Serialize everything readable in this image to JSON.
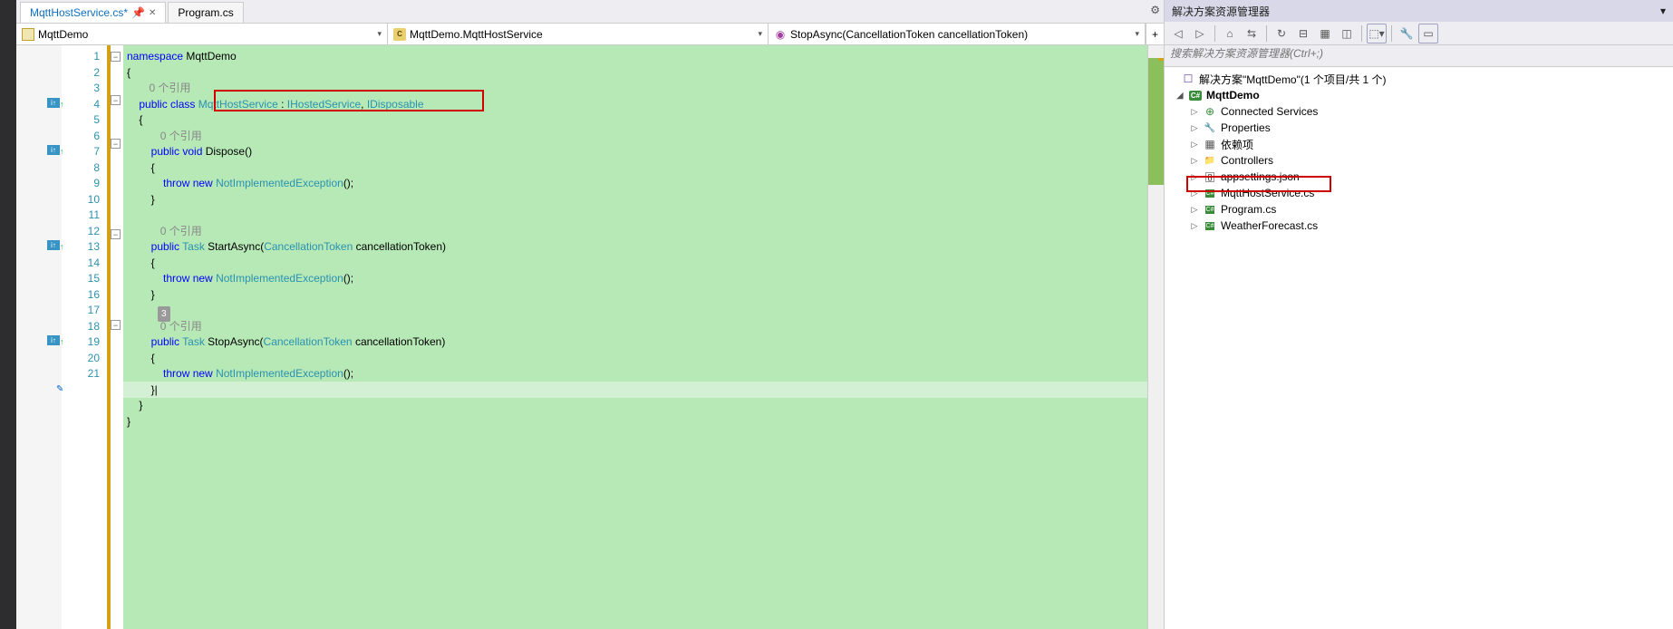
{
  "tabs": {
    "active": "MqttHostService.cs*",
    "pinned": "Program.cs",
    "close_glyph": "✕",
    "pin_glyph": "📌",
    "gear_glyph": "⚙"
  },
  "navbar": {
    "project": "MqttDemo",
    "class": "MqttDemo.MqttHostService",
    "member": "StopAsync(CancellationToken cancellationToken)"
  },
  "line_numbers": [
    "1",
    "2",
    "",
    "3",
    "4",
    "",
    "5",
    "6",
    "7",
    "8",
    "9",
    "",
    "10",
    "11",
    "12",
    "13",
    "14",
    "",
    "15",
    "16",
    "17",
    "18",
    "19",
    "20",
    "21"
  ],
  "codelens": {
    "ref0_a": "0 个引用",
    "ref0_b": "0 个引用",
    "ref0_c": "0 个引用",
    "ref3": "3",
    "ref0_d": "0 个引用"
  },
  "code": {
    "l1_kw": "namespace ",
    "l1_id": "MqttDemo",
    "l2": "{",
    "l3_kw": "public class ",
    "l3_t1": "MqttHostService",
    "l3_sep1": " : ",
    "l3_t2": "IHostedService",
    "l3_sep2": ", ",
    "l3_t3": "IDisposable",
    "l4": "    {",
    "l5_kw1": "public ",
    "l5_kw2": "void ",
    "l5_id": "Dispose()",
    "l6": "        {",
    "l7_kw1": "throw ",
    "l7_kw2": "new ",
    "l7_t": "NotImplementedException",
    "l7_tail": "();",
    "l8": "        }",
    "l9": "",
    "l10_kw": "public ",
    "l10_t1": "Task ",
    "l10_id": "StartAsync(",
    "l10_t2": "CancellationToken ",
    "l10_p": "cancellationToken)",
    "l11": "        {",
    "l12_kw1": "throw ",
    "l12_kw2": "new ",
    "l12_t": "NotImplementedException",
    "l12_tail": "();",
    "l13": "        }",
    "l14": "",
    "l15_kw": "public ",
    "l15_t1": "Task ",
    "l15_id": "StopAsync(",
    "l15_t2": "CancellationToken ",
    "l15_p": "cancellationToken)",
    "l16": "        {",
    "l17_kw1": "throw ",
    "l17_kw2": "new ",
    "l17_t": "NotImplementedException",
    "l17_tail": "();",
    "l18": "        }|",
    "l19": "    }",
    "l20": "}",
    "l21": ""
  },
  "margin_indicator": "i↑",
  "solution_explorer": {
    "title": "解决方案资源管理器",
    "search_placeholder": "搜索解决方案资源管理器(Ctrl+;)",
    "solution": "解决方案\"MqttDemo\"(1 个项目/共 1 个)",
    "project": "MqttDemo",
    "items": {
      "connected": "Connected Services",
      "properties": "Properties",
      "deps": "依赖项",
      "controllers": "Controllers",
      "appsettings": "appsettings.json",
      "mqtt": "MqttHostService.cs",
      "program": "Program.cs",
      "weather": "WeatherForecast.cs"
    }
  }
}
